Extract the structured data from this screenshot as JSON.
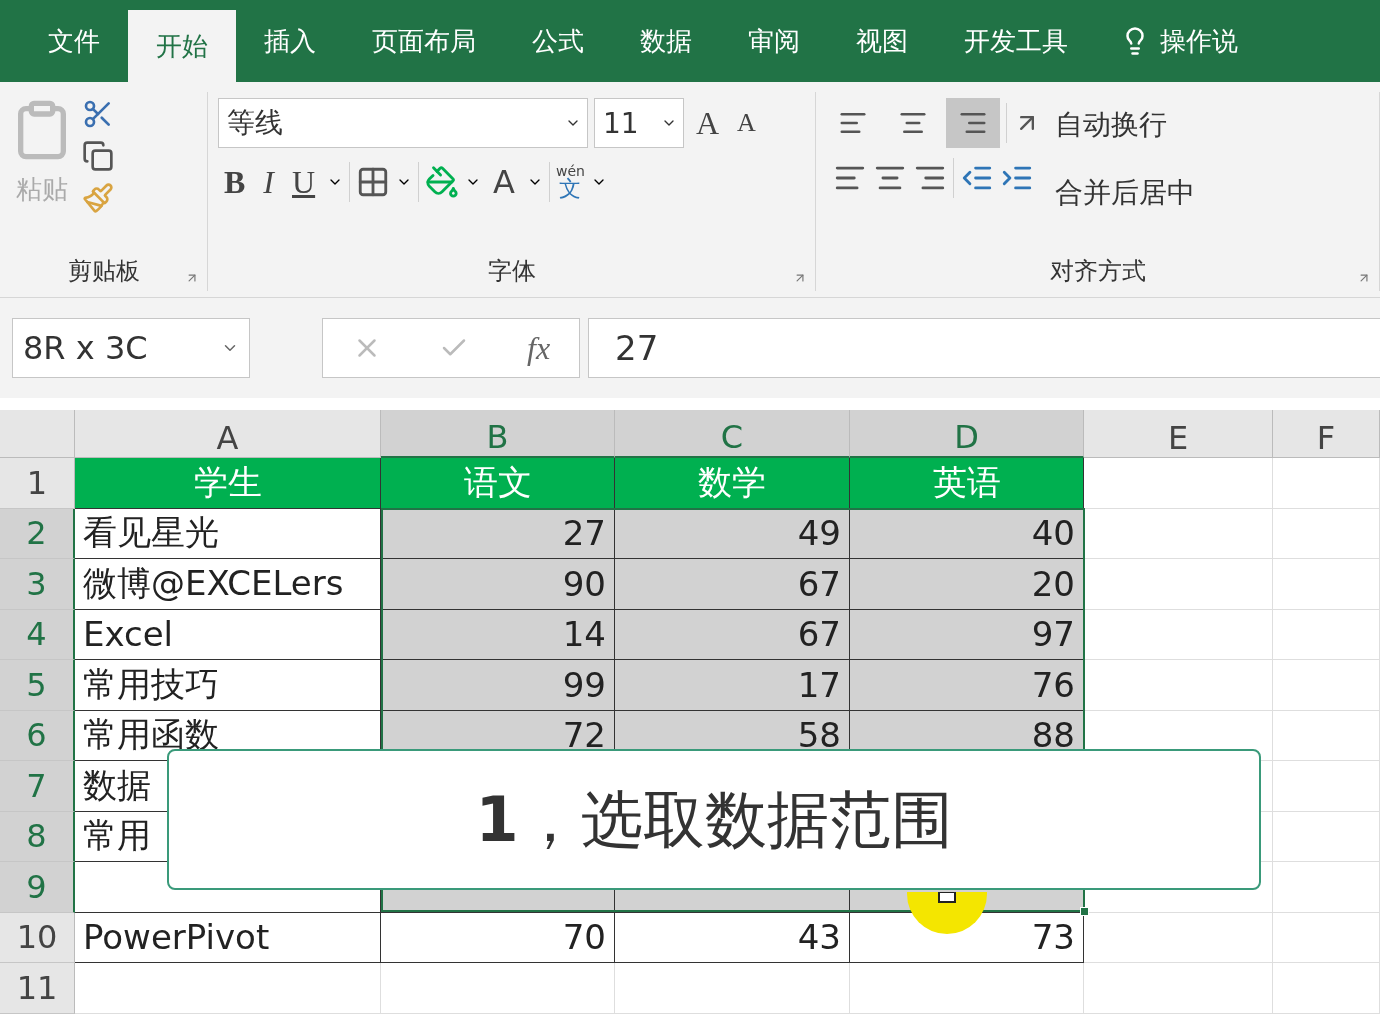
{
  "menu_tabs": [
    {
      "label": "文件",
      "selected": false
    },
    {
      "label": "开始",
      "selected": true
    },
    {
      "label": "插入",
      "selected": false
    },
    {
      "label": "页面布局",
      "selected": false
    },
    {
      "label": "公式",
      "selected": false
    },
    {
      "label": "数据",
      "selected": false
    },
    {
      "label": "审阅",
      "selected": false
    },
    {
      "label": "视图",
      "selected": false
    },
    {
      "label": "开发工具",
      "selected": false
    }
  ],
  "tell_me": "操作说",
  "ribbon": {
    "clipboard": {
      "paste_label": "粘贴",
      "paste_disabled": true,
      "group_label": "剪贴板"
    },
    "font": {
      "name": "等线",
      "size": "11",
      "grow": "A",
      "shrink": "A",
      "bold": "B",
      "italic": "I",
      "underline": "U",
      "font_color": "A",
      "phonetic_top": "wén",
      "phonetic_bottom": "文",
      "group_label": "字体"
    },
    "alignment": {
      "vertical": [
        {
          "kind": "top",
          "selected": false
        },
        {
          "kind": "middle",
          "selected": false
        },
        {
          "kind": "bottom",
          "selected": true
        }
      ],
      "wrap_text": "自动换行",
      "merge_center": "合并后居中",
      "group_label": "对齐方式"
    }
  },
  "name_box": "8R x 3C",
  "fx": "fx",
  "formula": "27",
  "columns": [
    {
      "label": "A",
      "selected": false
    },
    {
      "label": "B",
      "selected": true
    },
    {
      "label": "C",
      "selected": true
    },
    {
      "label": "D",
      "selected": true
    },
    {
      "label": "E",
      "selected": false
    },
    {
      "label": "F",
      "selected": false
    }
  ],
  "rows": [
    {
      "label": "1",
      "selected": false,
      "cells": [
        {
          "text": "学生",
          "kind": "header"
        },
        {
          "text": "语文",
          "kind": "header"
        },
        {
          "text": "数学",
          "kind": "header"
        },
        {
          "text": "英语",
          "kind": "header"
        }
      ]
    },
    {
      "label": "2",
      "selected": true,
      "cells": [
        {
          "text": "看见星光",
          "kind": "text",
          "selected": false
        },
        {
          "text": "27",
          "kind": "number",
          "selected": true
        },
        {
          "text": "49",
          "kind": "number",
          "selected": true
        },
        {
          "text": "40",
          "kind": "number",
          "selected": true
        }
      ]
    },
    {
      "label": "3",
      "selected": true,
      "cells": [
        {
          "text": "微博@EXCELers",
          "kind": "text",
          "selected": false
        },
        {
          "text": "90",
          "kind": "number",
          "selected": true
        },
        {
          "text": "67",
          "kind": "number",
          "selected": true
        },
        {
          "text": "20",
          "kind": "number",
          "selected": true
        }
      ]
    },
    {
      "label": "4",
      "selected": true,
      "cells": [
        {
          "text": "Excel",
          "kind": "text",
          "selected": false
        },
        {
          "text": "14",
          "kind": "number",
          "selected": true
        },
        {
          "text": "67",
          "kind": "number",
          "selected": true
        },
        {
          "text": "97",
          "kind": "number",
          "selected": true
        }
      ]
    },
    {
      "label": "5",
      "selected": true,
      "cells": [
        {
          "text": "常用技巧",
          "kind": "text",
          "selected": false
        },
        {
          "text": "99",
          "kind": "number",
          "selected": true
        },
        {
          "text": "17",
          "kind": "number",
          "selected": true
        },
        {
          "text": "76",
          "kind": "number",
          "selected": true
        }
      ]
    },
    {
      "label": "6",
      "selected": true,
      "cells": [
        {
          "text": "常用函数",
          "kind": "text",
          "selected": false
        },
        {
          "text": "72",
          "kind": "number",
          "selected": true
        },
        {
          "text": "58",
          "kind": "number",
          "selected": true
        },
        {
          "text": "88",
          "kind": "number",
          "selected": true
        }
      ]
    },
    {
      "label": "7",
      "selected": true,
      "cells": [
        {
          "text": "数据",
          "kind": "text",
          "selected": false
        }
      ]
    },
    {
      "label": "8",
      "selected": true,
      "cells": [
        {
          "text": "常用",
          "kind": "text",
          "selected": false
        }
      ]
    },
    {
      "label": "9",
      "selected": true,
      "cells": [
        {
          "kind": "text",
          "selected": false
        },
        {
          "kind": "number",
          "selected": true
        },
        {
          "kind": "number",
          "selected": true
        },
        {
          "kind": "number",
          "selected": true
        }
      ]
    },
    {
      "label": "10",
      "selected": false,
      "cells": [
        {
          "text": "PowerPivot",
          "kind": "text",
          "selected": false
        },
        {
          "text": "70",
          "kind": "number",
          "selected": false
        },
        {
          "text": "43",
          "kind": "number",
          "selected": false
        },
        {
          "text": "73",
          "kind": "number",
          "selected": false
        }
      ]
    },
    {
      "label": "11",
      "selected": false,
      "cells": []
    }
  ],
  "caption": "**1**，选取数据范围"
}
